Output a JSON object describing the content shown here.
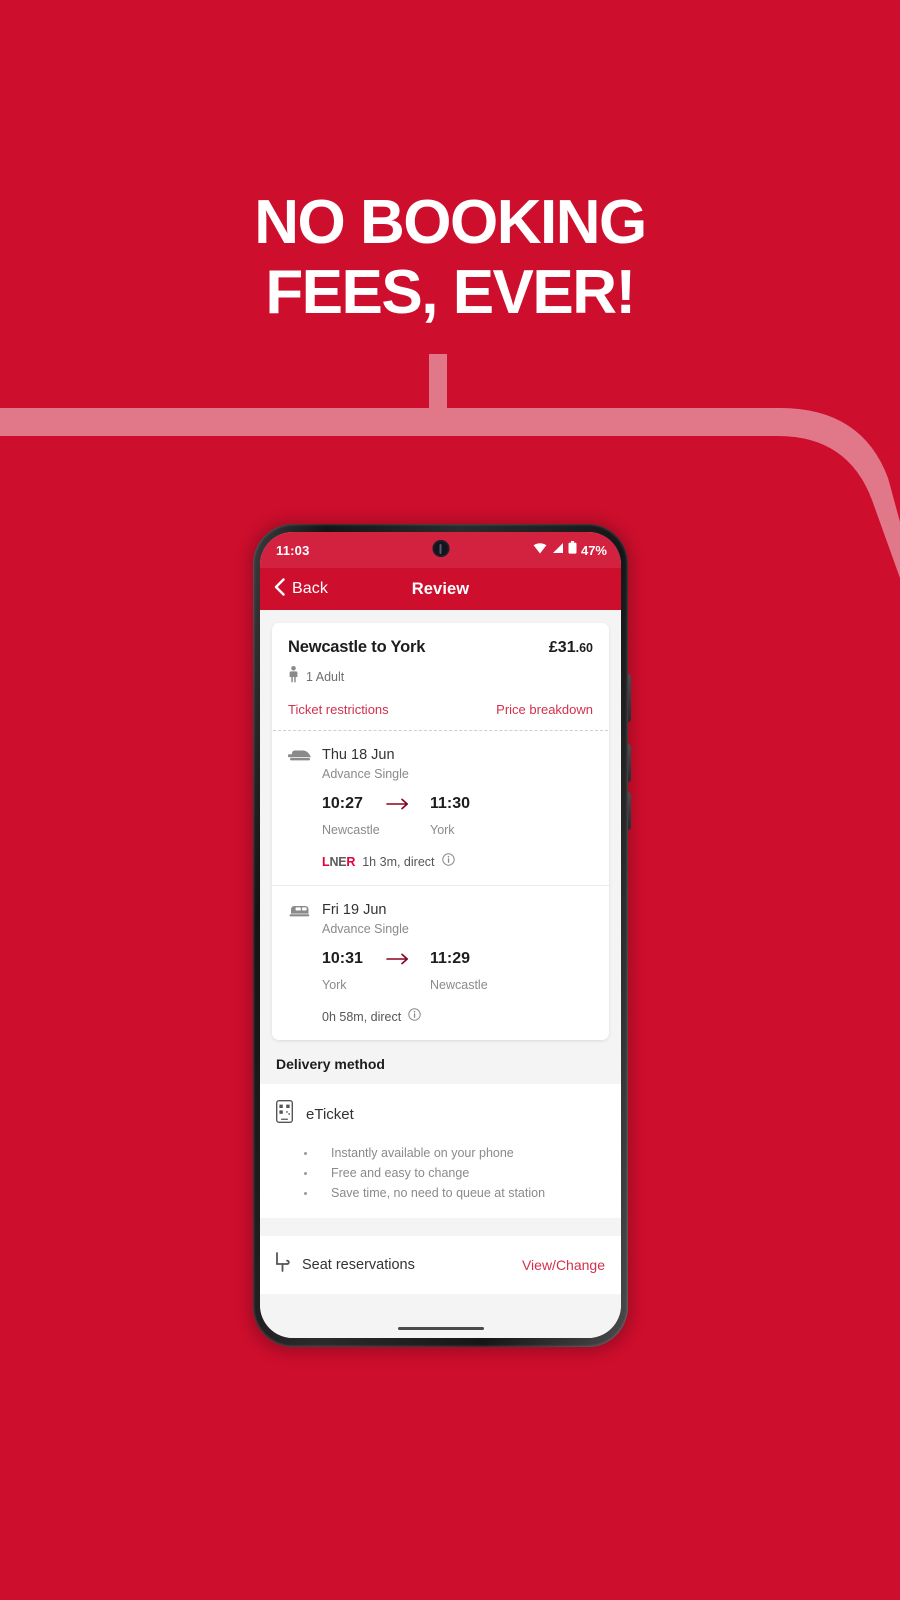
{
  "promo": {
    "headline_line1": "NO BOOKING",
    "headline_line2": "FEES, EVER!",
    "background_color": "#CE0E2D",
    "swoosh_color": "#E1788A"
  },
  "phone": {
    "status_bar": {
      "time": "11:03",
      "battery_percent": "47%",
      "wifi_icon": "wifi-icon",
      "signal_icon": "signal-icon",
      "battery_icon": "battery-icon",
      "camera_icon": "front-camera-punch-hole"
    },
    "header": {
      "back_label": "Back",
      "back_icon": "chevron-left-icon",
      "title": "Review"
    }
  },
  "ticket": {
    "route_title": "Newcastle to York",
    "price_major": "£31",
    "price_minor": ".60",
    "passenger_icon": "person-icon",
    "passengers": "1 Adult",
    "restrictions_link": "Ticket restrictions",
    "price_breakdown_link": "Price breakdown",
    "accent_color": "#D2304B",
    "legs": [
      {
        "icon": "train-front-icon",
        "date": "Thu 18 Jun",
        "fare_type": "Advance Single",
        "depart_time": "10:27",
        "arrive_time": "11:30",
        "arrow_icon": "arrow-right-icon",
        "depart_station": "Newcastle",
        "arrive_station": "York",
        "operator_prefix": "L",
        "operator_mid": "NE",
        "operator_suffix": "R",
        "duration": "1h 3m, direct",
        "info_icon": "info-circle-icon"
      },
      {
        "icon": "train-side-icon",
        "date": "Fri 19 Jun",
        "fare_type": "Advance Single",
        "depart_time": "10:31",
        "arrive_time": "11:29",
        "arrow_icon": "arrow-right-icon",
        "depart_station": "York",
        "arrive_station": "Newcastle",
        "operator_prefix": "",
        "operator_mid": "",
        "operator_suffix": "",
        "duration": "0h 58m, direct",
        "info_icon": "info-circle-icon"
      }
    ]
  },
  "delivery": {
    "section_title": "Delivery method",
    "method_icon": "eticket-phone-icon",
    "method_label": "eTicket",
    "benefits": [
      "Instantly available on your phone",
      "Free and easy to change",
      "Save time, no need to queue at station"
    ]
  },
  "seat_reservations": {
    "icon": "seat-icon",
    "label": "Seat reservations",
    "action_label": "View/Change"
  }
}
